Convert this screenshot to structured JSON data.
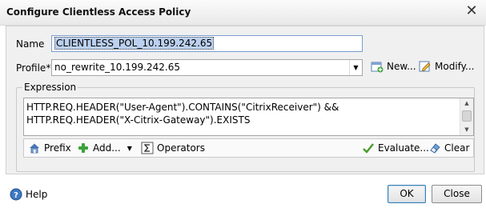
{
  "window": {
    "title": "Configure Clientless Access Policy",
    "close_glyph": "✕"
  },
  "form": {
    "name_label": "Name",
    "name_value": "CLIENTLESS_POL_10.199.242.65",
    "profile_label": "Profile*",
    "profile_value": "no_rewrite_10.199.242.65",
    "new_label": "New...",
    "modify_label": "Modify..."
  },
  "expression": {
    "legend": "Expression",
    "lines": [
      "HTTP.REQ.HEADER(\"User-Agent\").CONTAINS(\"CitrixReceiver\") &&",
      "HTTP.REQ.HEADER(\"X-Citrix-Gateway\").EXISTS"
    ],
    "toolbar": {
      "prefix_label": "Prefix",
      "add_label": "Add...",
      "operators_label": "Operators",
      "evaluate_label": "Evaluate...",
      "clear_label": "Clear"
    }
  },
  "footer": {
    "help_label": "Help",
    "ok_label": "OK",
    "close_label": "Close"
  },
  "icons": {
    "new": "new-icon",
    "modify": "edit-icon",
    "prefix": "house-icon",
    "add": "green-plus-icon",
    "operators": "sigma-icon",
    "evaluate": "checkmark-icon",
    "clear": "eraser-icon",
    "help": "help-icon"
  },
  "colors": {
    "accent": "#3c7fb1",
    "selection": "#bcd1f0",
    "add_green": "#3aa23a",
    "evaluate_green": "#4a9a2e"
  }
}
